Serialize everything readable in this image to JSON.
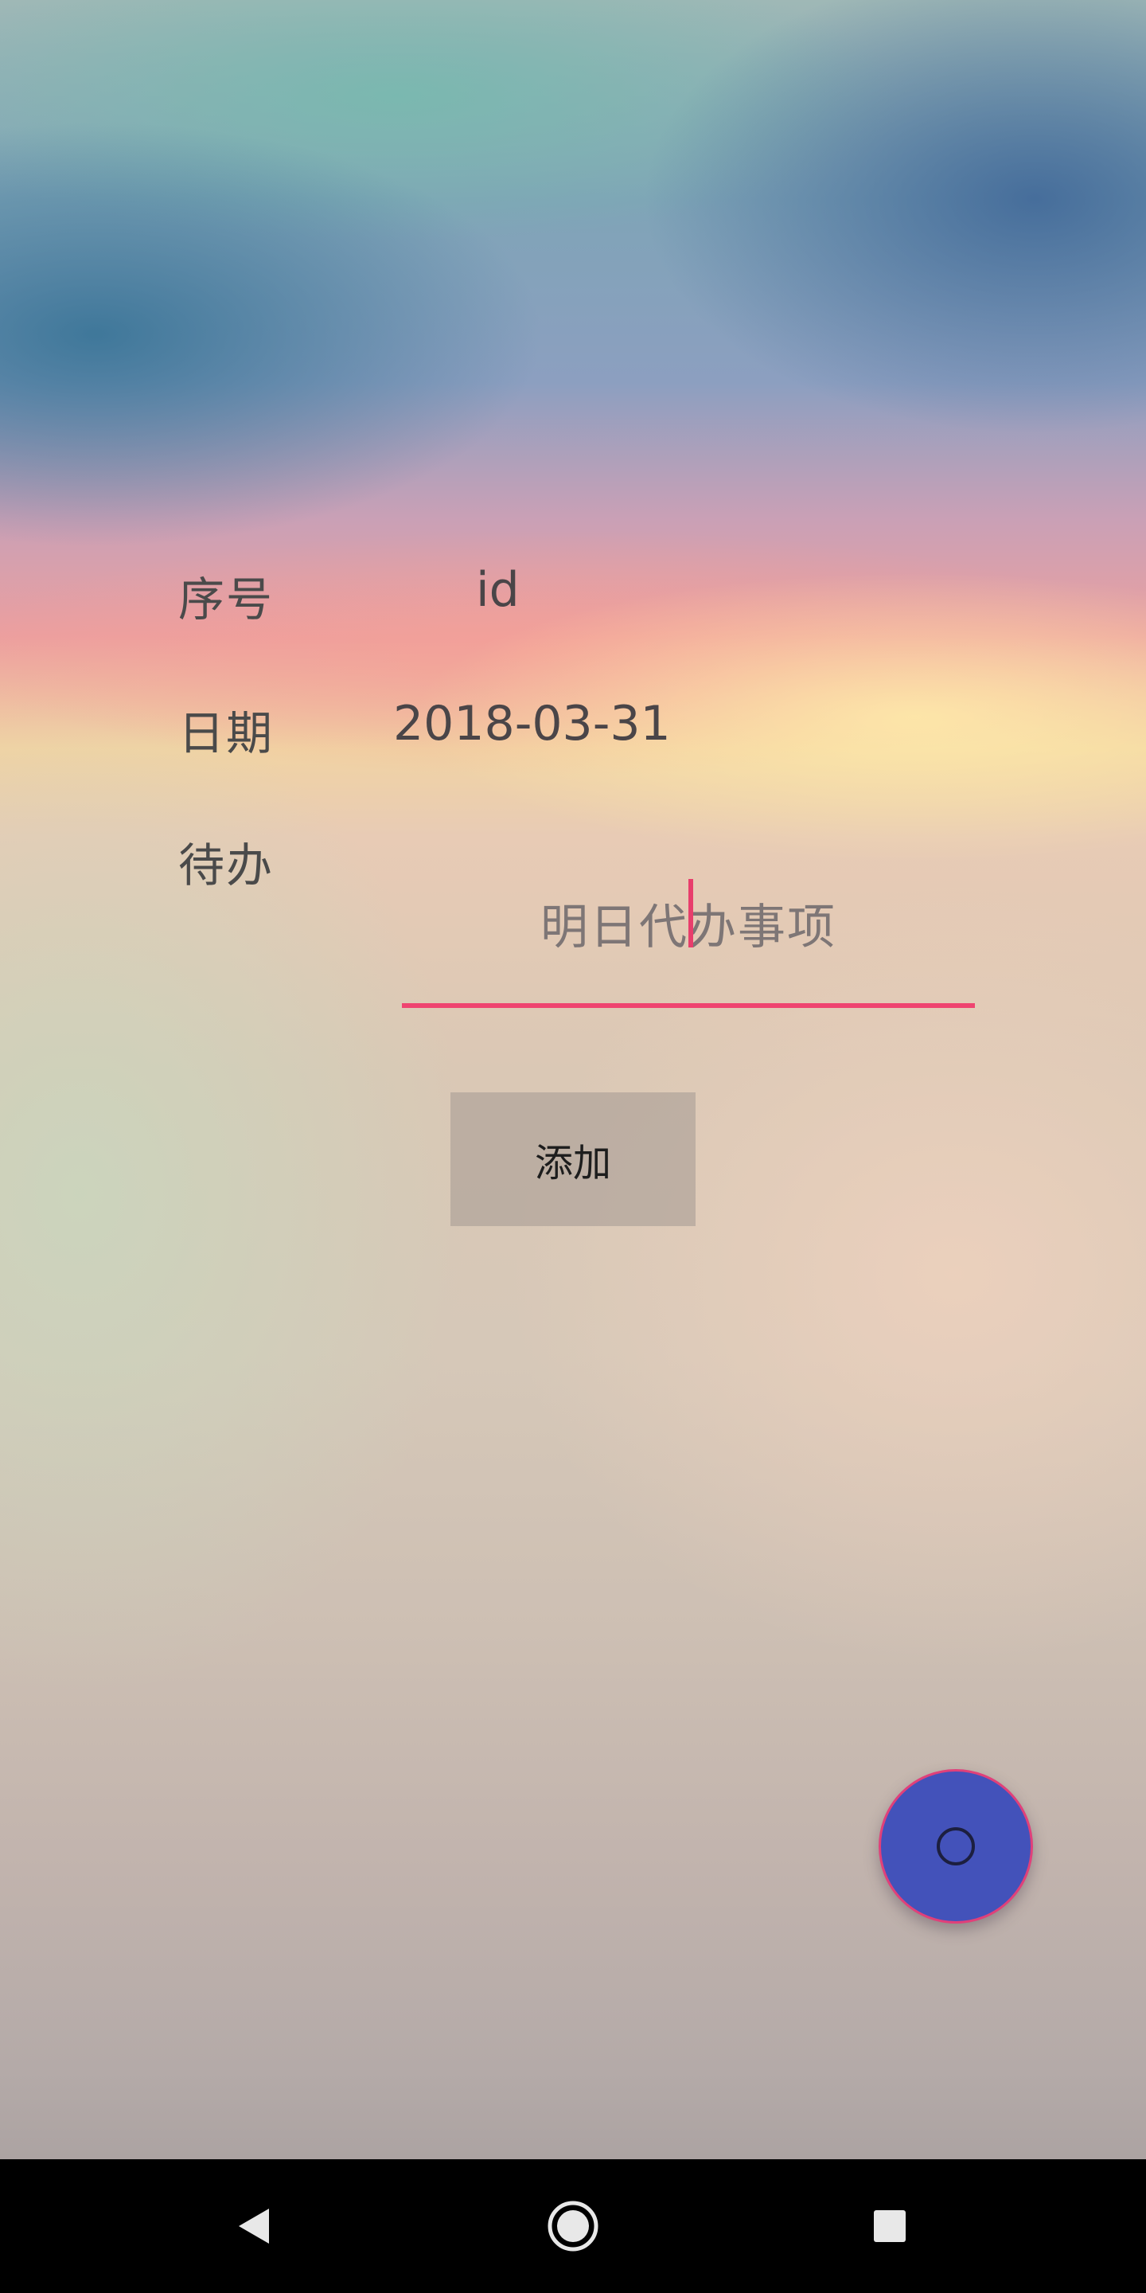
{
  "form": {
    "id_label": "序号",
    "id_value": "id",
    "date_label": "日期",
    "date_value": "2018-03-31",
    "todo_label": "待办",
    "todo_input_value": "明日代办事项",
    "add_button_label": "添加"
  },
  "fab": {
    "icon": "circle-icon"
  },
  "navbar": {
    "icons": [
      "back-triangle-icon",
      "home-circle-icon",
      "recents-square-icon"
    ]
  },
  "colors": {
    "accent": "#ef4470",
    "fab": "#4352ba",
    "navbar": "#000000"
  }
}
